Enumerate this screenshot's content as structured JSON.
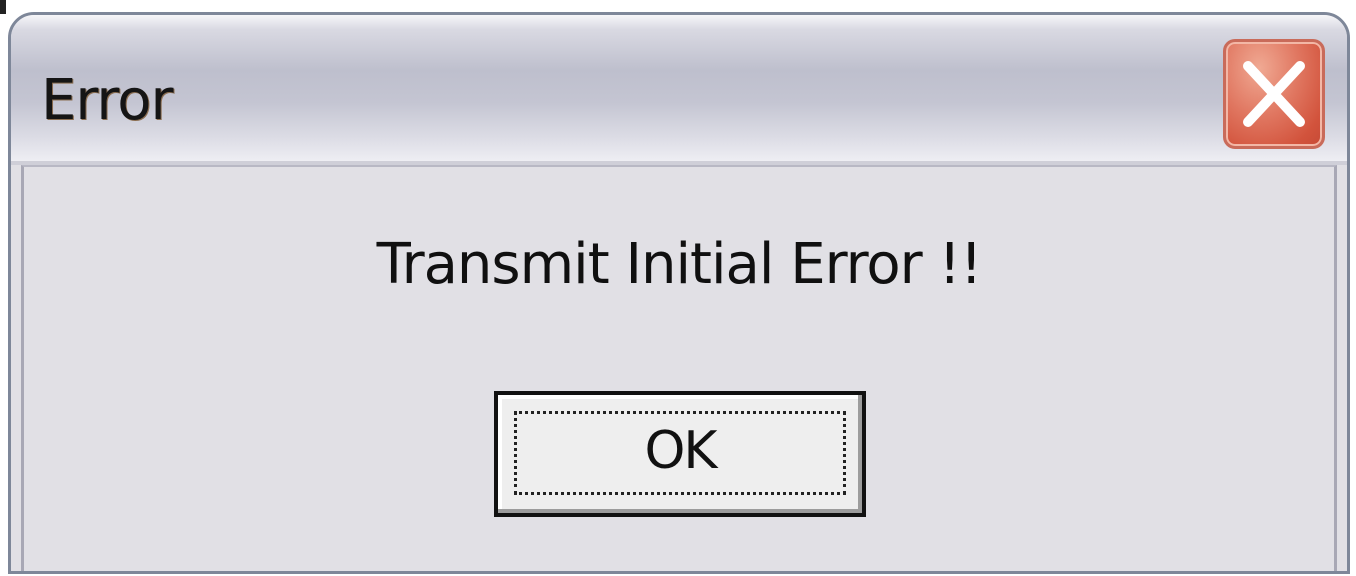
{
  "dialog": {
    "title": "Error",
    "message": "Transmit Initial Error !!",
    "ok_label": "OK",
    "close_icon": "close-icon"
  },
  "colors": {
    "titlebar_top": "#f6f6f9",
    "titlebar_mid": "#bebfcd",
    "close_button": "#d2533c",
    "client_area": "#e1e0e5",
    "window_border": "#7e8799",
    "text": "#101010"
  }
}
